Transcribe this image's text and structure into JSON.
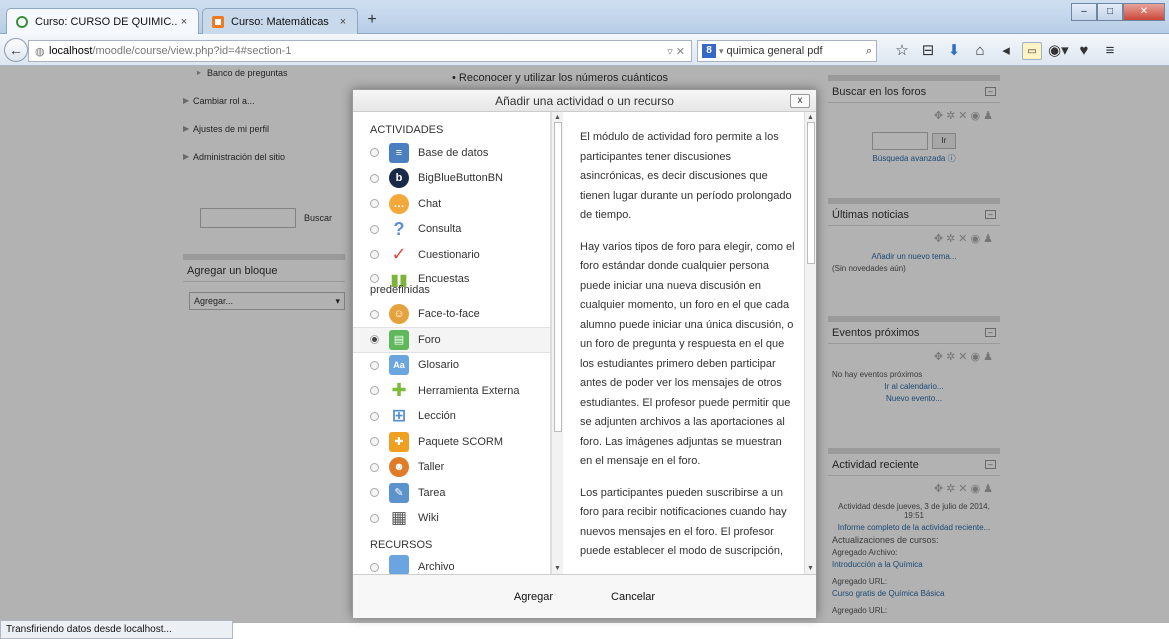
{
  "colors": {
    "tabbar": "#b7cde6",
    "overlay": "rgba(0,0,0,0.30)",
    "link": "#2a6aa7",
    "selected_row": "#f4f4f4"
  },
  "browser": {
    "tabs": [
      {
        "title": "Curso: CURSO DE QUIMIC...",
        "icon": "loading-ring-icon",
        "active": true
      },
      {
        "title": "Curso: Matemáticas",
        "icon": "moodle-favicon-icon",
        "active": false
      }
    ],
    "new_tab": "+",
    "url_host": "localhost",
    "url_path": "/moodle/course/view.php?id=4#section-1",
    "search_query": "quimica general pdf",
    "search_engine_icon": "8",
    "status": "Transfiriendo datos desde localhost..."
  },
  "page": {
    "left_items": [
      "Banco de preguntas",
      "Cambiar rol a...",
      "Ajustes de mi perfil",
      "Administración del sitio"
    ],
    "search_button": "Buscar",
    "add_block": {
      "title": "Agregar un bloque",
      "select_value": "Agregar..."
    },
    "bullet_text": "Reconocer y utilizar los números cuánticos",
    "right_blocks": {
      "forum_search": {
        "title": "Buscar en los foros",
        "go": "Ir",
        "advanced": "Búsqueda avanzada"
      },
      "news": {
        "title": "Últimas noticias",
        "add_topic": "Añadir un nuevo tema...",
        "empty": "(Sin novedades aún)"
      },
      "events": {
        "title": "Eventos próximos",
        "empty": "No hay eventos próximos",
        "calendar": "Ir al calendario...",
        "new_event": "Nuevo evento..."
      },
      "recent": {
        "title": "Actividad reciente",
        "since": "Actividad desde jueves, 3 de julio de 2014, 19:51",
        "full_report": "Informe completo de la actividad reciente...",
        "updates": "Actualizaciones de cursos:",
        "item1_label": "Agregado Archivo:",
        "item1_value": "Introducción a la Química",
        "item2_label": "Agregado URL:",
        "item2_value": "Curso gratis de Química Básica",
        "item3_label": "Agregado URL:"
      }
    }
  },
  "modal": {
    "title": "Añadir una actividad o un recurso",
    "close": "x",
    "activities_label": "ACTIVIDADES",
    "resources_label": "RECURSOS",
    "activities": [
      {
        "label": "Base de datos",
        "icon": "database-icon",
        "color": "#4a7fc1",
        "glyph": "≡",
        "selected": false
      },
      {
        "label": "BigBlueButtonBN",
        "icon": "bigbluebutton-icon",
        "color": "#1a2b4a",
        "glyph": "b",
        "selected": false
      },
      {
        "label": "Chat",
        "icon": "chat-icon",
        "color": "#f2a83b",
        "glyph": "…",
        "selected": false
      },
      {
        "label": "Consulta",
        "icon": "question-icon",
        "color": "#5b8fd6",
        "glyph": "?",
        "selected": false
      },
      {
        "label": "Cuestionario",
        "icon": "quiz-check-icon",
        "color": "#e14b3b",
        "glyph": "✓",
        "selected": false
      },
      {
        "label": "Encuestas",
        "label2": "predefinidas",
        "icon": "survey-chart-icon",
        "color": "#7fb43a",
        "glyph": "▮",
        "selected": false
      },
      {
        "label": "Face-to-face",
        "icon": "face-to-face-icon",
        "color": "#e6a23c",
        "glyph": "☺",
        "selected": false
      },
      {
        "label": "Foro",
        "icon": "forum-icon",
        "color": "#5fb85a",
        "glyph": "▤",
        "selected": true
      },
      {
        "label": "Glosario",
        "icon": "glossary-icon",
        "color": "#6aa5e0",
        "glyph": "Aa",
        "selected": false
      },
      {
        "label": "Herramienta Externa",
        "icon": "external-tool-icon",
        "color": "#7dbb3c",
        "glyph": "✚",
        "selected": false
      },
      {
        "label": "Lección",
        "icon": "lesson-icon",
        "color": "#4f8cd2",
        "glyph": "⊞",
        "selected": false
      },
      {
        "label": "Paquete SCORM",
        "icon": "scorm-package-icon",
        "color": "#f0a020",
        "glyph": "✚",
        "selected": false
      },
      {
        "label": "Taller",
        "icon": "workshop-icon",
        "color": "#e07b28",
        "glyph": "☻",
        "selected": false
      },
      {
        "label": "Tarea",
        "icon": "assignment-icon",
        "color": "#5c93cc",
        "glyph": "✎",
        "selected": false
      },
      {
        "label": "Wiki",
        "icon": "wiki-icon",
        "color": "#555555",
        "glyph": "▦",
        "selected": false
      }
    ],
    "resource_first_label": "Archivo",
    "description": [
      "El módulo de actividad foro permite a los participantes tener discusiones asincrónicas, es decir discusiones que tienen lugar durante un período prolongado de tiempo.",
      "Hay varios tipos de foro para elegir, como el foro estándar donde cualquier persona puede iniciar una nueva discusión en cualquier momento, un foro en el que cada alumno puede iniciar una única discusión, o un foro de pregunta y respuesta en el que los estudiantes primero deben participar antes de poder ver los mensajes de otros estudiantes. El profesor puede permitir que se adjunten archivos a las aportaciones al foro. Las imágenes adjuntas se muestran en el mensaje en el foro.",
      "Los participantes pueden suscribirse a un foro para recibir notificaciones cuando hay nuevos mensajes en el foro. El profesor puede establecer el modo de suscripción,"
    ],
    "add_button": "Agregar",
    "cancel_button": "Cancelar"
  }
}
